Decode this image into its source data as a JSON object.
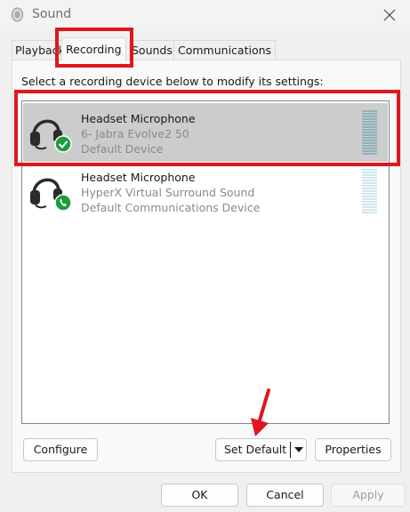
{
  "window": {
    "title": "Sound",
    "icon": "speaker-icon"
  },
  "tabs": [
    {
      "label": "Playback"
    },
    {
      "label": "Recording",
      "active": true
    },
    {
      "label": "Sounds"
    },
    {
      "label": "Communications"
    }
  ],
  "instruction": "Select a recording device below to modify its settings:",
  "devices": [
    {
      "name": "Headset Microphone",
      "description": "6- Jabra Evolve2 50",
      "status": "Default Device",
      "badge": "check-badge-icon",
      "selected": true
    },
    {
      "name": "Headset Microphone",
      "description": "HyperX Virtual Surround Sound",
      "status": "Default Communications Device",
      "badge": "phone-badge-icon",
      "selected": false
    }
  ],
  "buttons": {
    "configure": "Configure",
    "set_default": "Set Default",
    "properties": "Properties",
    "ok": "OK",
    "cancel": "Cancel",
    "apply": "Apply"
  },
  "colors": {
    "highlight": "#e0161f",
    "badge_green": "#1e9c3c",
    "selection": "#cccccc"
  }
}
